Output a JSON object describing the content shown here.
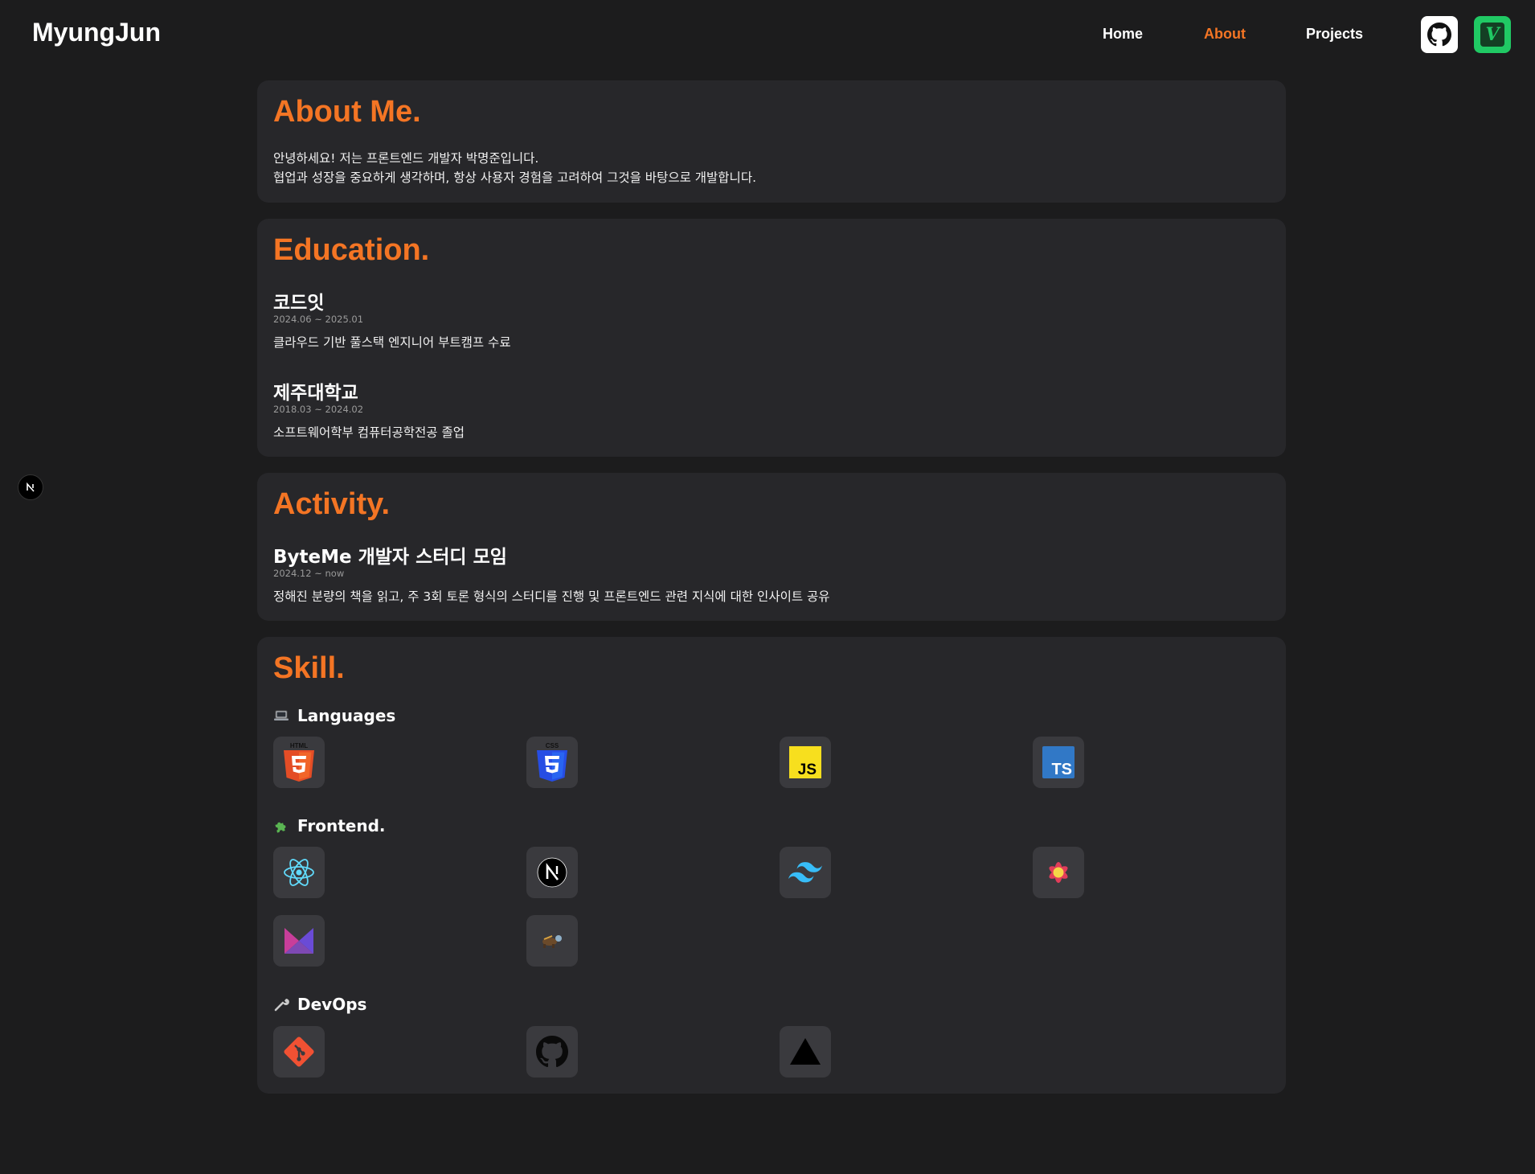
{
  "header": {
    "logo": "MyungJun",
    "nav": {
      "home": "Home",
      "about": "About",
      "projects": "Projects"
    },
    "active_nav": "About",
    "accent_color": "#f47524",
    "social": [
      {
        "name": "github",
        "icon": "github-icon"
      },
      {
        "name": "velog",
        "icon": "velog-icon",
        "glyph": "V"
      }
    ]
  },
  "floating_badge": {
    "glyph": "N"
  },
  "about": {
    "title": "About Me.",
    "lines": [
      "안녕하세요! 저는 프론트엔드 개발자 박명준입니다.",
      "협업과 성장을 중요하게 생각하며, 항상 사용자 경험을 고려하여 그것을 바탕으로 개발합니다."
    ]
  },
  "education": {
    "title": "Education.",
    "items": [
      {
        "name": "코드잇",
        "period": "2024.06 ~ 2025.01",
        "desc": "클라우드 기반 풀스택 엔지니어 부트캠프 수료"
      },
      {
        "name": "제주대학교",
        "period": "2018.03 ~ 2024.02",
        "desc": "소프트웨어학부 컴퓨터공학전공 졸업"
      }
    ]
  },
  "activity": {
    "title": "Activity.",
    "items": [
      {
        "name": "ByteMe 개발자 스터디 모임",
        "period": "2024.12 ~ now",
        "desc": "정해진 분량의 책을 읽고, 주 3회 토론 형식의 스터디를 진행 및 프론트엔드 관련 지식에 대한 인사이트 공유"
      }
    ]
  },
  "skill": {
    "title": "Skill.",
    "categories": {
      "languages": {
        "label": "Languages",
        "icon": "laptop-icon",
        "items": [
          "html5-icon",
          "css3-icon",
          "javascript-icon",
          "typescript-icon"
        ]
      },
      "frontend": {
        "label": "Frontend.",
        "icon": "puzzle-icon",
        "items": [
          "react-icon",
          "nextjs-icon",
          "tailwind-icon",
          "recoil-icon",
          "framer-motion-icon",
          "zustand-icon"
        ]
      },
      "devops": {
        "label": "DevOps",
        "icon": "wrench-icon",
        "items": [
          "git-icon",
          "github-icon",
          "vercel-icon"
        ]
      }
    },
    "icon_text": {
      "css_badge": "CSS",
      "html_badge": "HTML",
      "js": "JS",
      "ts": "TS"
    }
  }
}
